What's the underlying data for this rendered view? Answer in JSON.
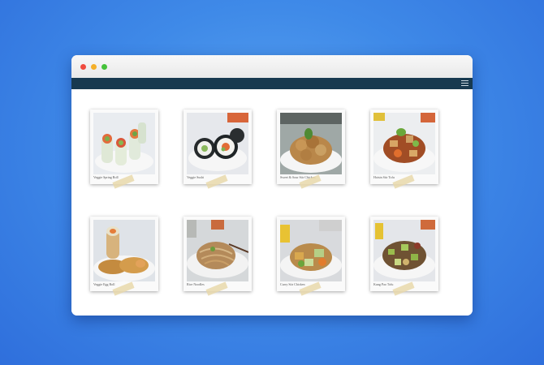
{
  "window": {
    "controls": [
      "close-dot",
      "minimize-dot",
      "zoom-dot"
    ],
    "menu_icon": "hamburger-menu-icon"
  },
  "gallery": {
    "items": [
      {
        "caption": "Veggie Spring Roll"
      },
      {
        "caption": "Veggie Sushi"
      },
      {
        "caption": "Sweet & Sour Stir Chicken"
      },
      {
        "caption": "Hoisin Stir Tofu"
      },
      {
        "caption": "Veggie Egg Roll"
      },
      {
        "caption": "Rice Noodles"
      },
      {
        "caption": "Curry Stir Chicken"
      },
      {
        "caption": "Kung Pao Tofu"
      }
    ]
  }
}
